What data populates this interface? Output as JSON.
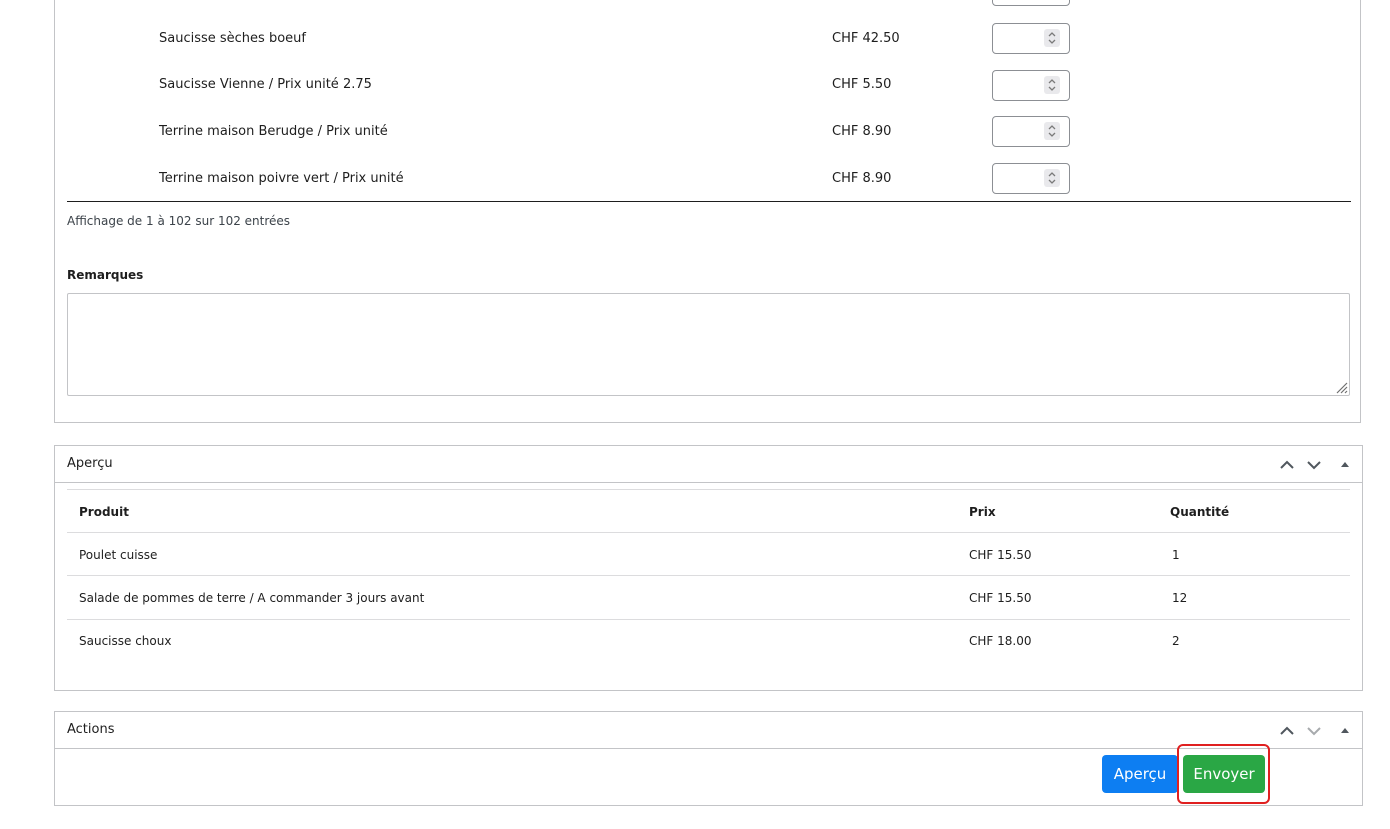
{
  "products": {
    "rows": [
      {
        "name": "Saucisse sèches boeuf",
        "price": "CHF 42.50",
        "quantity": ""
      },
      {
        "name": "Saucisse Vienne / Prix unité 2.75",
        "price": "CHF 5.50",
        "quantity": ""
      },
      {
        "name": "Terrine maison Berudge / Prix unité",
        "price": "CHF 8.90",
        "quantity": ""
      },
      {
        "name": "Terrine maison poivre vert / Prix unité",
        "price": "CHF 8.90",
        "quantity": ""
      }
    ],
    "info": "Affichage de 1 à 102 sur 102 entrées",
    "remarks_label": "Remarques",
    "remarks_value": ""
  },
  "preview": {
    "title": "Aperçu",
    "columns": [
      "Produit",
      "Prix",
      "Quantité"
    ],
    "rows": [
      {
        "product": "Poulet cuisse",
        "price": "CHF 15.50",
        "quantity": "1"
      },
      {
        "product": "Salade de pommes de terre / A commander 3 jours avant",
        "price": "CHF 15.50",
        "quantity": "12"
      },
      {
        "product": "Saucisse choux",
        "price": "CHF 18.00",
        "quantity": "2"
      }
    ]
  },
  "actions": {
    "title": "Actions",
    "preview_button": "Aperçu",
    "send_button": "Envoyer"
  },
  "icons": {
    "move_up": "chevron-up-icon",
    "move_down": "chevron-down-icon",
    "toggle": "triangle-up-icon",
    "spinner": "spinner-arrows-icon",
    "resize": "resize-grip-icon"
  },
  "colors": {
    "primary_button": "#0d7ef2",
    "success_button": "#2aa745",
    "highlight": "#e02020",
    "border": "#c3c4c7"
  }
}
